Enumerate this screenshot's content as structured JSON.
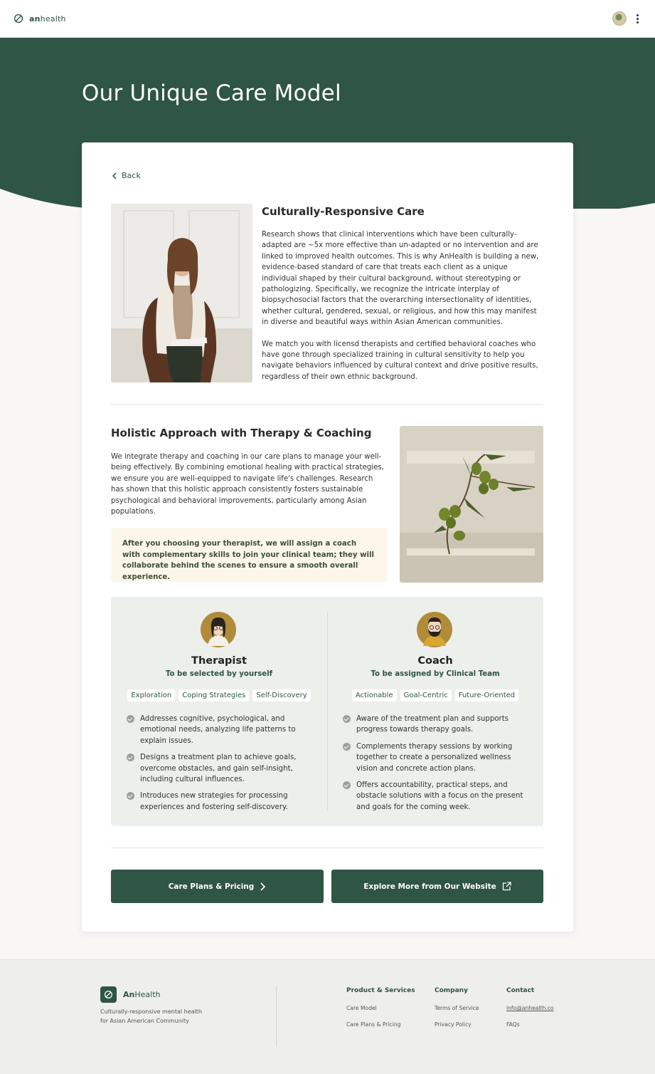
{
  "app": {
    "brand_name": "anhealth",
    "brand_color": "#2f5544"
  },
  "hero": {
    "title": "Our Unique Care Model",
    "bg_color": "#2f5544"
  },
  "card": {
    "back_label": "Back",
    "section1": {
      "title": "Culturally-Responsive Care",
      "paragraph1": "Research shows that clinical interventions which have been culturally-adapted are ~5x more effective than un-adapted or no intervention and are linked to improved health outcomes. This is why AnHealth is building a new, evidence-based standard of care that treats each client as a unique individual shaped by their cultural background, without stereotyping or pathologizing. Specifically, we recognize the intricate interplay of biopsychosocial factors that the overarching intersectionality of identities, whether cultural, gendered, sexual, or religious, and how this may manifest in diverse and beautiful ways within Asian American communities.",
      "paragraph2": "We match you with licensd therapists and certified behavioral coaches who have gone through specialized training in cultural sensitivity to help you navigate behaviors influenced by cultural context and drive positive results, regardless of their own ethnic background."
    },
    "section2": {
      "title": "Holistic Approach with Therapy & Coaching",
      "paragraph": "We integrate therapy and coaching in our care plans to manage your well-being effectively. By combining emotional healing with practical strategies, we ensure you are well-equipped to navigate life's challenges. Research has shown that this holistic approach consistently fosters sustainable psychological and behavioral improvements, particularly among Asian populations.",
      "note": "After you choosing your therapist, we will assign a coach with complementary skills to join your clinical team; they will collaborate behind the scenes to ensure a smooth overall experience."
    },
    "therapist": {
      "title": "Therapist",
      "subtitle": "To be selected by yourself",
      "tags": [
        "Exploration",
        "Coping Strategies",
        "Self-Discovery"
      ],
      "bullets": [
        "Addresses cognitive, psychological, and emotional needs, analyzing life patterns to explain issues.",
        "Designs a treatment plan to achieve goals, overcome obstacles, and gain self-insight, including cultural influences.",
        "Introduces new strategies for processing experiences and fostering self-discovery."
      ]
    },
    "coach": {
      "title": "Coach",
      "subtitle": "To be assigned by Clinical Team",
      "tags": [
        "Actionable",
        "Goal-Centric",
        "Future-Oriented"
      ],
      "bullets": [
        "Aware of the treatment plan and supports progress towards therapy goals.",
        "Complements therapy sessions by working together to create a personalized wellness vision and concrete action plans.",
        "Offers accountability, practical steps, and obstacle solutions with a focus on the present and goals for the coming week."
      ]
    },
    "buttons": {
      "pricing": "Care Plans & Pricing",
      "explore": "Explore More from Our Website"
    }
  },
  "footer": {
    "brand_bold": "An",
    "brand_rest": "Health",
    "tagline": "Culturally-responsive mental health for Asian American Community",
    "columns": [
      {
        "heading": "Product & Services",
        "links": [
          "Care Model",
          "Care Plans & Pricing"
        ]
      },
      {
        "heading": "Company",
        "links": [
          "Terms of Service",
          "Privacy Policy"
        ]
      },
      {
        "heading": "Contact",
        "links": [
          "info@anhealth.co",
          "FAQs"
        ]
      }
    ]
  }
}
